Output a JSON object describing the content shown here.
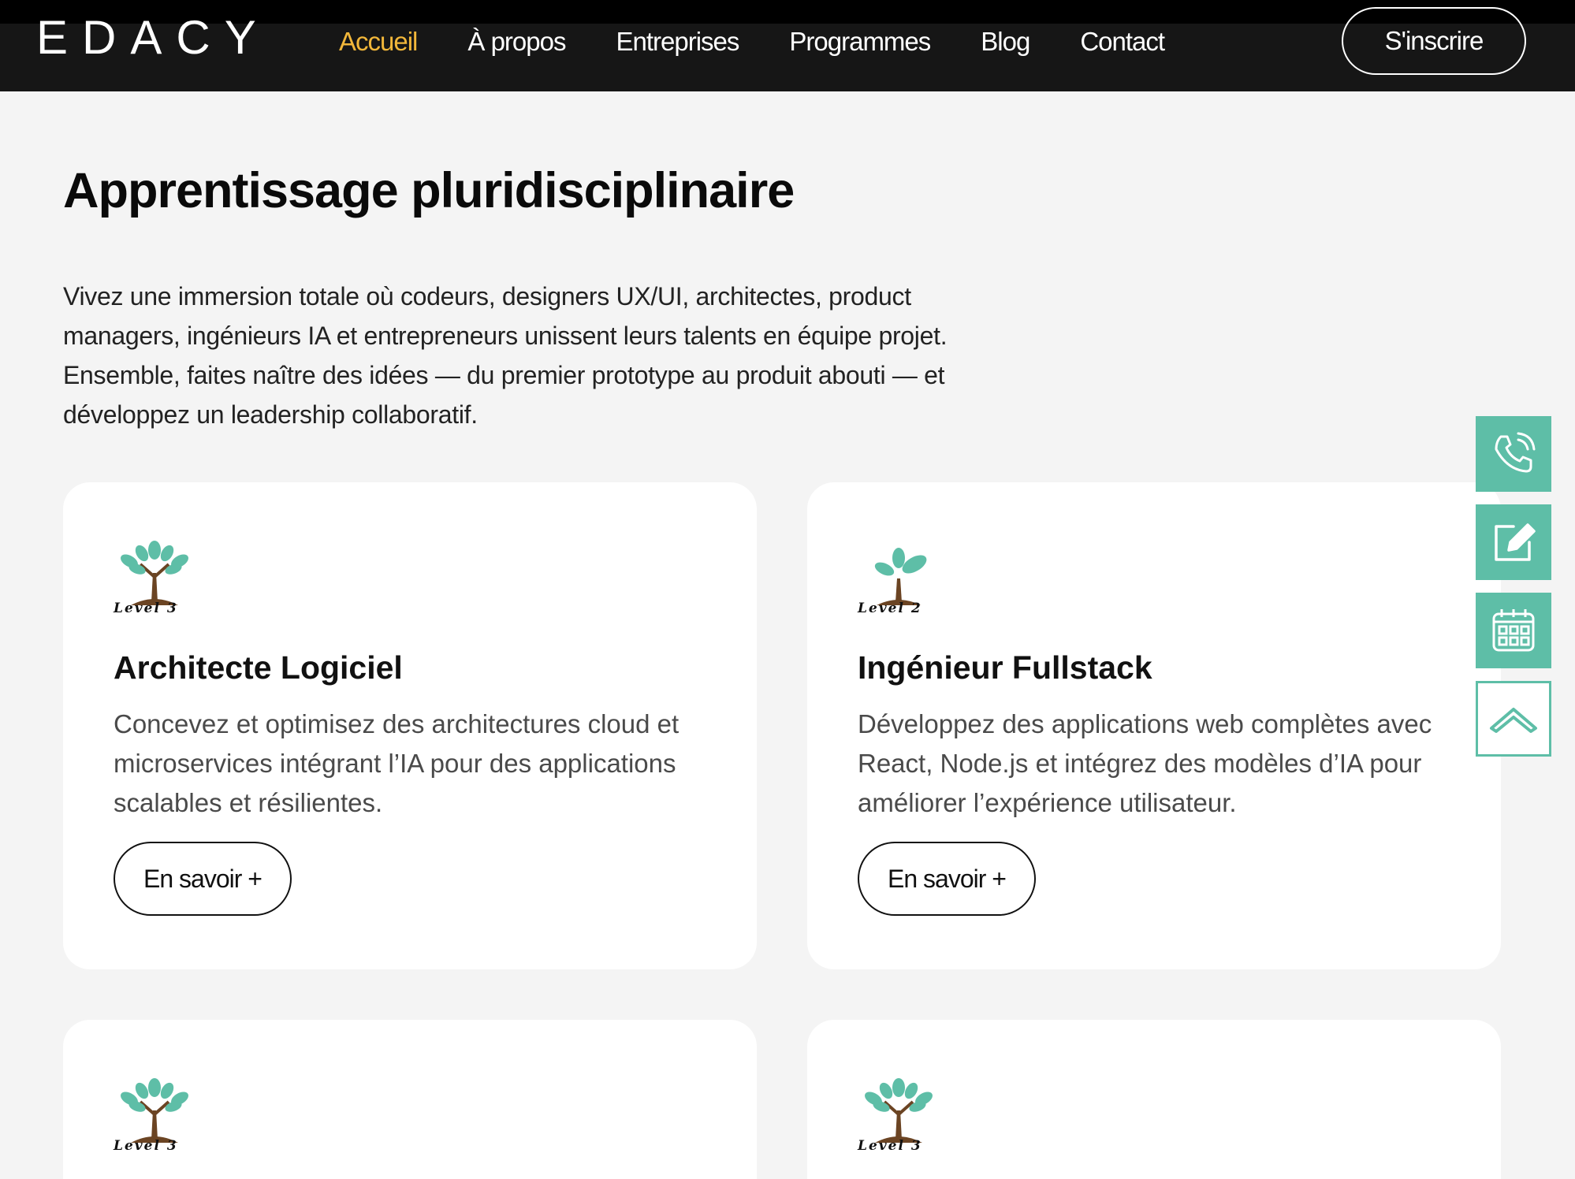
{
  "brand": {
    "logo": "EDACY"
  },
  "nav": {
    "items": [
      {
        "label": "Accueil",
        "active": true
      },
      {
        "label": "À propos",
        "active": false
      },
      {
        "label": "Entreprises",
        "active": false
      },
      {
        "label": "Programmes",
        "active": false
      },
      {
        "label": "Blog",
        "active": false
      },
      {
        "label": "Contact",
        "active": false
      }
    ],
    "signup_label": "S'inscrire"
  },
  "section": {
    "title": "Apprentissage pluridisciplinaire",
    "intro": "Vivez une immersion totale où codeurs, designers UX/UI, architectes, product managers, ingénieurs IA et entrepreneurs unissent leurs talents en équipe projet. Ensemble, faites naître des idées — du premier prototype au produit abouti — et développez un leadership collaboratif."
  },
  "cards": [
    {
      "level": "Level 3",
      "title": "Architecte Logiciel",
      "description": "Concevez et optimisez des architectures cloud et microservices intégrant l’IA pour des applications scalables et résilientes.",
      "button": "En savoir +"
    },
    {
      "level": "Level 2",
      "title": "Ingénieur Fullstack",
      "description": "Développez des applications web complètes avec React, Node.js et intégrez des modèles d’IA pour améliorer l’expérience utilisateur.",
      "button": "En savoir +"
    },
    {
      "level": "Level 3"
    },
    {
      "level": "Level 3"
    }
  ],
  "side_tools": [
    {
      "icon": "phone-icon"
    },
    {
      "icon": "edit-icon"
    },
    {
      "icon": "calendar-icon"
    },
    {
      "icon": "chevron-up-icon"
    }
  ],
  "colors": {
    "accent": "#f2b73a",
    "teal": "#5ebea7",
    "navbar": "#161616",
    "background": "#f4f4f4"
  }
}
